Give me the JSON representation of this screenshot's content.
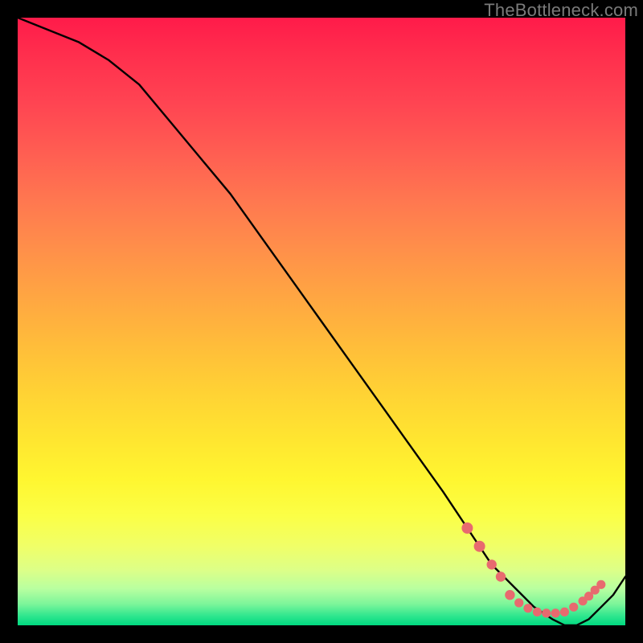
{
  "watermark": "TheBottleneck.com",
  "colors": {
    "page_bg": "#000000",
    "curve": "#000000",
    "dot": "#e86a6f",
    "watermark": "#7a7a7a"
  },
  "chart_data": {
    "type": "line",
    "title": "",
    "xlabel": "",
    "ylabel": "",
    "xlim": [
      0,
      100
    ],
    "ylim": [
      0,
      100
    ],
    "grid": false,
    "series": [
      {
        "name": "curve",
        "x": [
          0,
          5,
          10,
          15,
          20,
          25,
          30,
          35,
          40,
          45,
          50,
          55,
          60,
          65,
          70,
          74,
          78,
          82,
          85,
          88,
          90,
          92,
          94,
          96,
          98,
          100
        ],
        "y": [
          100,
          98,
          96,
          93,
          89,
          83,
          77,
          71,
          64,
          57,
          50,
          43,
          36,
          29,
          22,
          16,
          10,
          6,
          3,
          1,
          0,
          0,
          1,
          3,
          5,
          8
        ]
      }
    ],
    "points": [
      {
        "x": 74,
        "y": 16
      },
      {
        "x": 76,
        "y": 13
      },
      {
        "x": 78,
        "y": 10
      },
      {
        "x": 79.5,
        "y": 8
      },
      {
        "x": 81,
        "y": 5
      },
      {
        "x": 82.5,
        "y": 3.7
      },
      {
        "x": 84,
        "y": 2.8
      },
      {
        "x": 85.5,
        "y": 2.2
      },
      {
        "x": 87,
        "y": 2.0
      },
      {
        "x": 88.5,
        "y": 2.0
      },
      {
        "x": 90,
        "y": 2.2
      },
      {
        "x": 91.5,
        "y": 3.0
      },
      {
        "x": 93,
        "y": 4.0
      },
      {
        "x": 94,
        "y": 4.8
      },
      {
        "x": 95,
        "y": 5.8
      },
      {
        "x": 96,
        "y": 6.7
      }
    ]
  }
}
